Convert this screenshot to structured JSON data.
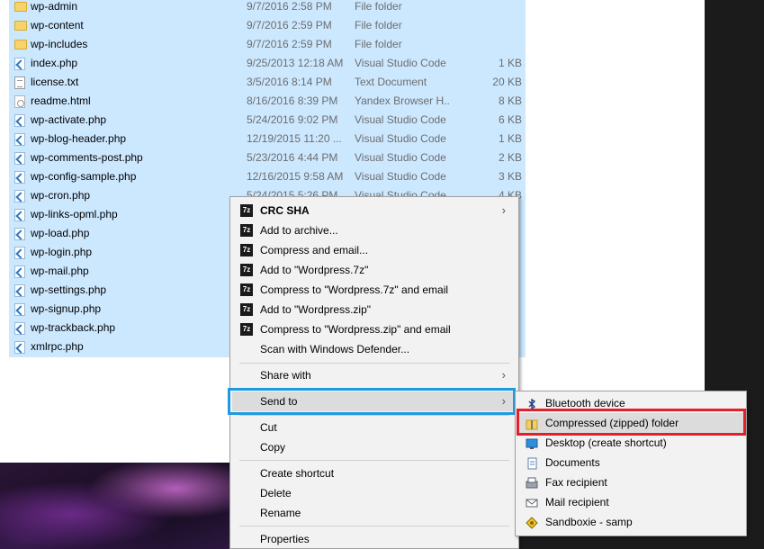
{
  "files": [
    {
      "name": "wp-admin",
      "date": "9/7/2016 2:58 PM",
      "type": "File folder",
      "size": "",
      "icon": "folder-icon"
    },
    {
      "name": "wp-content",
      "date": "9/7/2016 2:59 PM",
      "type": "File folder",
      "size": "",
      "icon": "folder-icon"
    },
    {
      "name": "wp-includes",
      "date": "9/7/2016 2:59 PM",
      "type": "File folder",
      "size": "",
      "icon": "folder-icon"
    },
    {
      "name": "index.php",
      "date": "9/25/2013 12:18 AM",
      "type": "Visual Studio Code",
      "size": "1 KB",
      "icon": "vscode-file-icon"
    },
    {
      "name": "license.txt",
      "date": "3/5/2016 8:14 PM",
      "type": "Text Document",
      "size": "20 KB",
      "icon": "text-file-icon"
    },
    {
      "name": "readme.html",
      "date": "8/16/2016 8:39 PM",
      "type": "Yandex Browser H...",
      "size": "8 KB",
      "icon": "html-file-icon"
    },
    {
      "name": "wp-activate.php",
      "date": "5/24/2016 9:02 PM",
      "type": "Visual Studio Code",
      "size": "6 KB",
      "icon": "vscode-file-icon"
    },
    {
      "name": "wp-blog-header.php",
      "date": "12/19/2015 11:20 ...",
      "type": "Visual Studio Code",
      "size": "1 KB",
      "icon": "vscode-file-icon"
    },
    {
      "name": "wp-comments-post.php",
      "date": "5/23/2016 4:44 PM",
      "type": "Visual Studio Code",
      "size": "2 KB",
      "icon": "vscode-file-icon"
    },
    {
      "name": "wp-config-sample.php",
      "date": "12/16/2015 9:58 AM",
      "type": "Visual Studio Code",
      "size": "3 KB",
      "icon": "vscode-file-icon"
    },
    {
      "name": "wp-cron.php",
      "date": "5/24/2015 5:26 PM",
      "type": "Visual Studio Code",
      "size": "4 KB",
      "icon": "vscode-file-icon"
    },
    {
      "name": "wp-links-opml.php",
      "date": "",
      "type": "",
      "size": "",
      "icon": "vscode-file-icon"
    },
    {
      "name": "wp-load.php",
      "date": "",
      "type": "",
      "size": "",
      "icon": "vscode-file-icon"
    },
    {
      "name": "wp-login.php",
      "date": "",
      "type": "",
      "size": "",
      "icon": "vscode-file-icon"
    },
    {
      "name": "wp-mail.php",
      "date": "",
      "type": "",
      "size": "",
      "icon": "vscode-file-icon"
    },
    {
      "name": "wp-settings.php",
      "date": "",
      "type": "",
      "size": "",
      "icon": "vscode-file-icon"
    },
    {
      "name": "wp-signup.php",
      "date": "",
      "type": "",
      "size": "",
      "icon": "vscode-file-icon"
    },
    {
      "name": "wp-trackback.php",
      "date": "",
      "type": "",
      "size": "",
      "icon": "vscode-file-icon"
    },
    {
      "name": "xmlrpc.php",
      "date": "",
      "type": "",
      "size": "",
      "icon": "vscode-file-icon"
    }
  ],
  "context_menu": {
    "crc_sha": "CRC SHA",
    "add_to_archive": "Add to archive...",
    "compress_and_email": "Compress and email...",
    "add_to_7z": "Add to \"Wordpress.7z\"",
    "compress_7z_email": "Compress to \"Wordpress.7z\" and email",
    "add_to_zip": "Add to \"Wordpress.zip\"",
    "compress_zip_email": "Compress to \"Wordpress.zip\" and email",
    "scan_defender": "Scan with Windows Defender...",
    "share_with": "Share with",
    "send_to": "Send to",
    "cut": "Cut",
    "copy": "Copy",
    "create_shortcut": "Create shortcut",
    "delete": "Delete",
    "rename": "Rename",
    "properties": "Properties",
    "sevenzip_icon_text": "7z"
  },
  "send_to_menu": {
    "bluetooth": "Bluetooth device",
    "compressed_folder": "Compressed (zipped) folder",
    "desktop": "Desktop (create shortcut)",
    "documents": "Documents",
    "fax": "Fax recipient",
    "mail": "Mail recipient",
    "sandboxie": "Sandboxie - samp"
  },
  "colors": {
    "selection": "#cce8ff",
    "send_to_highlight": "#1e9ae0",
    "zip_highlight": "#e3202a"
  }
}
